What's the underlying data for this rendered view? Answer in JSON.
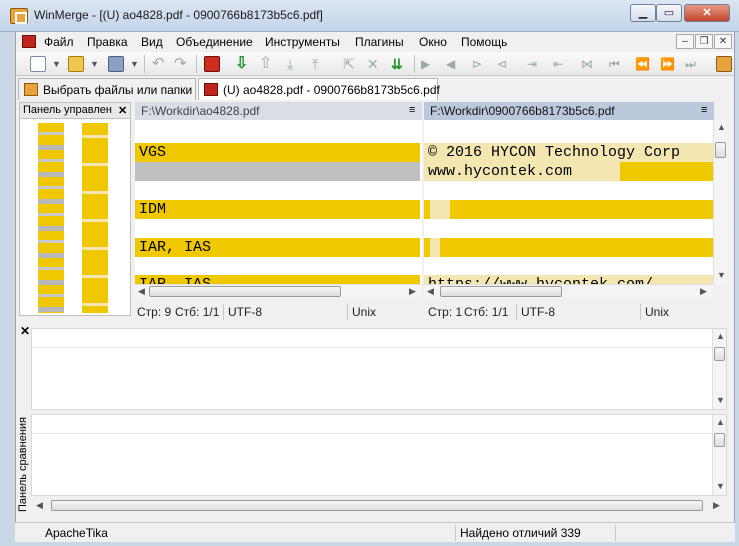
{
  "window": {
    "title": "WinMerge - [(U) ao4828.pdf - 0900766b8173b5c6.pdf]"
  },
  "menu": [
    "Файл",
    "Правка",
    "Вид",
    "Объединение",
    "Инструменты",
    "Плагины",
    "Окно",
    "Помощь"
  ],
  "tabs": [
    {
      "label": "Выбрать файлы или папки"
    },
    {
      "label": "(U) ao4828.pdf - 0900766b8173b5c6.pdf"
    }
  ],
  "location_pane": {
    "title": "Панель управлен"
  },
  "left_pane": {
    "path": "F:\\Workdir\\ao4828.pdf",
    "lines": [
      "VGS",
      "",
      "",
      "IDM",
      "",
      "IAR, IAS",
      "",
      "IAR, IAS"
    ],
    "status": {
      "position": "Стр: 9",
      "column": "Стб: 1/1",
      "encoding": "UTF-8",
      "eol": "Unix"
    }
  },
  "right_pane": {
    "path": "F:\\Workdir\\0900766b8173b5c6.pdf",
    "lines": [
      "© 2016 HYCON Technology Corp",
      "www.hycontek.com",
      "",
      "",
      "",
      "",
      "",
      "https://www.hycontek.com/"
    ],
    "status": {
      "position": "Стр: 1",
      "column": "Стб: 1/1",
      "encoding": "UTF-8",
      "eol": "Unix"
    }
  },
  "compare_pane": {
    "label": "Панель сравнения"
  },
  "statusbar": {
    "plugin": "ApacheTika",
    "diff_count": "Найдено отличий 339"
  },
  "colors": {
    "diff": "#f0c800",
    "diff_light": "#f4e6b0",
    "missing": "#c0c0c0"
  }
}
